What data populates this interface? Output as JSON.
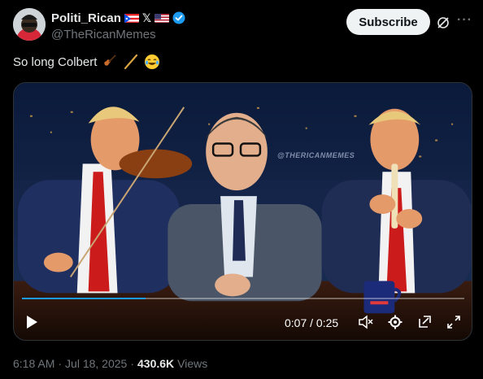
{
  "author": {
    "display_name": "Politi_Rican",
    "handle": "@TheRicanMemes",
    "flags": [
      "pr-flag-icon",
      "x-logo-icon",
      "us-flag-icon"
    ],
    "verified": true,
    "x_label": "𝕏"
  },
  "header": {
    "subscribe_label": "Subscribe",
    "more_label": "···"
  },
  "tweet": {
    "text": "So long Colbert",
    "emojis": [
      "violin-emoji",
      "violin-bow-emoji",
      "laughing-tears-emoji"
    ]
  },
  "media": {
    "watermark": "@THERICANMEMES",
    "progress": 0.28,
    "current_time": "0:07",
    "duration": "0:25",
    "time_display": "0:07 / 0:25"
  },
  "footer": {
    "time": "6:18 AM",
    "date": "Jul 18, 2025",
    "views_count": "430.6K",
    "views_label": "Views",
    "separator": "·"
  },
  "colors": {
    "background": "#000000",
    "text_primary": "#e7e9ea",
    "text_secondary": "#71767b",
    "accent": "#1d9bf0",
    "subscribe_bg": "#eff3f4"
  }
}
